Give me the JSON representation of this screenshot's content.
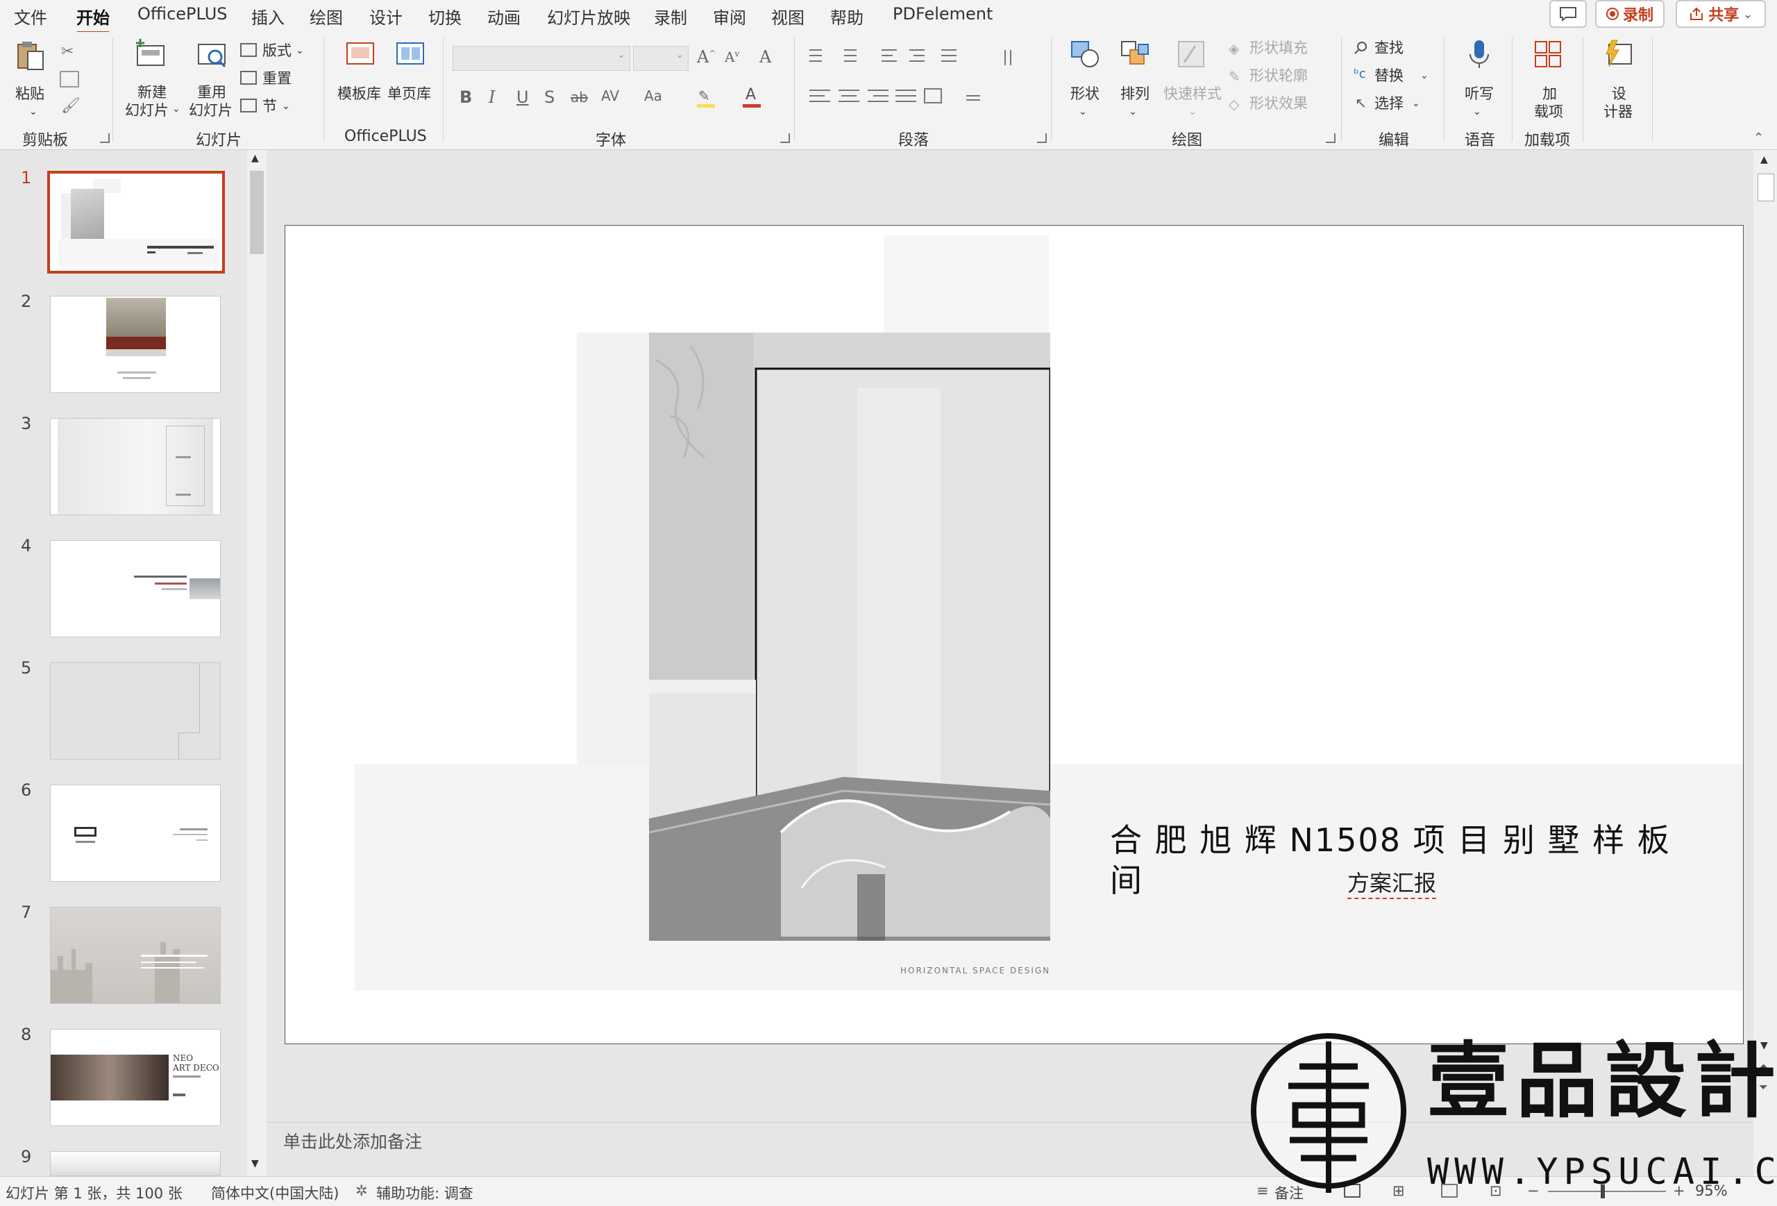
{
  "menubar": {
    "items": [
      "文件",
      "开始",
      "OfficePLUS",
      "插入",
      "绘图",
      "设计",
      "切换",
      "动画",
      "幻灯片放映",
      "录制",
      "审阅",
      "视图",
      "帮助",
      "PDFelement"
    ],
    "active": "开始",
    "record_label": "录制",
    "share_label": "共享"
  },
  "ribbon": {
    "groups": {
      "clipboard": "剪贴板",
      "slides": "幻灯片",
      "officeplus": "OfficePLUS",
      "font": "字体",
      "paragraph": "段落",
      "drawing": "绘图",
      "editing": "编辑",
      "voice": "语音",
      "addins": "加载项"
    },
    "paste": "粘贴",
    "new_slide_1": "新建",
    "new_slide_2": "幻灯片",
    "reuse_1": "重用",
    "reuse_2": "幻灯片",
    "layout": "版式",
    "reset": "重置",
    "section": "节",
    "template_lib": "模板库",
    "single_page_lib": "单页库",
    "shapes": "形状",
    "arrange": "排列",
    "quick_styles": "快速样式",
    "shape_fill": "形状填充",
    "shape_outline": "形状轮廓",
    "shape_effects": "形状效果",
    "find": "查找",
    "replace": "替换",
    "select": "选择",
    "dictate": "听写",
    "addins_1": "加",
    "addins_2": "载项",
    "designer_1": "设",
    "designer_2": "计器",
    "font_buttons": [
      "B",
      "I",
      "U",
      "S",
      "ab",
      "AV",
      "Aa"
    ]
  },
  "thumbnails": {
    "numbers": [
      "1",
      "2",
      "3",
      "4",
      "5",
      "6",
      "7",
      "8",
      "9"
    ],
    "selected": "1",
    "thumb8_title_1": "NEO",
    "thumb8_title_2": "ART DECO"
  },
  "slide": {
    "title_line1": "合 肥 旭  辉 N1508 项 目 别  墅 样  板",
    "title_line2": "间",
    "subtitle": "方案汇报",
    "caption": "HORIZONTAL SPACE DESIGN"
  },
  "notes": {
    "placeholder": "单击此处添加备注"
  },
  "statusbar": {
    "slide_info": "幻灯片 第 1 张，共 100 张",
    "language": "简体中文(中国大陆)",
    "accessibility": "辅助功能: 调查",
    "notes_label": "备注",
    "zoom": "95%"
  },
  "watermark": {
    "logo_char": "壹",
    "brand": "壹品設計",
    "url": "WWW.YPSUCAI.COM"
  },
  "colors": {
    "accent": "#c43e1c",
    "ribbon_bg": "#f3f3f3",
    "pane_bg": "#e6e6e6"
  }
}
